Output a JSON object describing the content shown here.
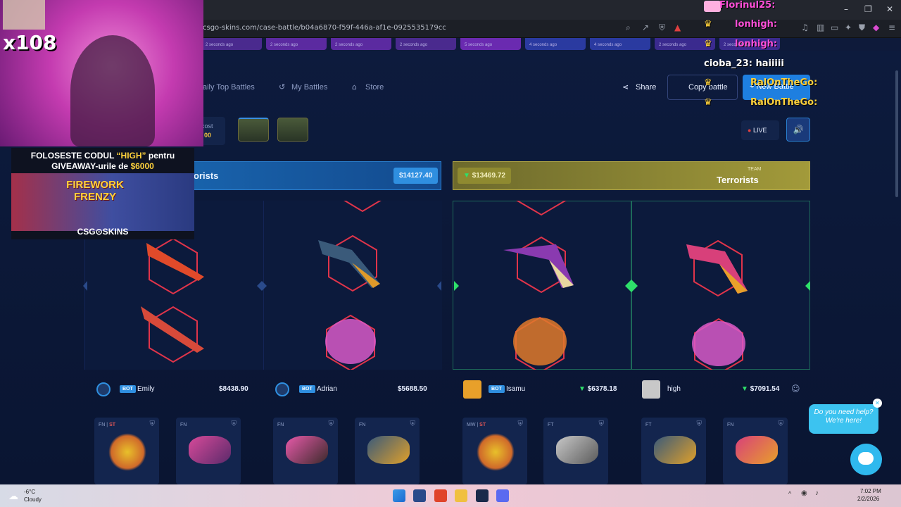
{
  "browser": {
    "url": "csgo-skins.com/case-battle/b04a6870-f59f-446a-af1e-0925535179cc",
    "window_controls": [
      "–",
      "❐",
      "✕"
    ]
  },
  "ticker": {
    "times": [
      "2 seconds ago",
      "2 seconds ago",
      "2 seconds ago",
      "2 seconds ago",
      "5 seconds ago",
      "4 seconds ago",
      "4 seconds ago",
      "2 seconds ago",
      "2 seconds ago"
    ]
  },
  "nav": {
    "daily_top_battles": "aily Top Battles",
    "my_battles": "My Battles",
    "store": "Store",
    "share": "Share",
    "copy_battle": "Copy battle",
    "new_battle": "+ New Battle",
    "live": "LIVE"
  },
  "battle": {
    "cost_label": "cost",
    "cost_value": "00",
    "ct": {
      "name": "orists",
      "value": "$14127.40"
    },
    "t": {
      "team_label": "TEAM",
      "name": "Terrorists",
      "value": "$13469.72"
    }
  },
  "players": [
    {
      "name": "Emily",
      "badge": "BOT",
      "value": "$8438.90"
    },
    {
      "name": "Adrian",
      "badge": "BOT",
      "value": "$5688.50"
    },
    {
      "name": "Isamu",
      "badge": "BOT",
      "value": "$6378.18"
    },
    {
      "name": "high",
      "badge": "",
      "value": "$7091.54"
    }
  ],
  "cards": [
    {
      "cond": "FN",
      "st": "ST"
    },
    {
      "cond": "FN",
      "st": ""
    },
    {
      "cond": "FN",
      "st": ""
    },
    {
      "cond": "FN",
      "st": ""
    },
    {
      "cond": "MW",
      "st": "ST"
    },
    {
      "cond": "FT",
      "st": ""
    },
    {
      "cond": "FT",
      "st": ""
    },
    {
      "cond": "FN",
      "st": ""
    }
  ],
  "stream": {
    "multiplier": "x108",
    "promo_line1": "FOLOSESTE CODUL",
    "promo_code": "“HIGH”",
    "promo_line1_end": "pentru",
    "promo_line2": "GIVEAWAY-urile de",
    "promo_amount": "$6000",
    "promo_game": "FIREWORK FRENZY",
    "promo_brand": "CSG⊙SKINS"
  },
  "chat": [
    {
      "text": "Florinul25:",
      "color": "#ff4fd8"
    },
    {
      "text": "lonhigh:",
      "color": "#ff4fd8"
    },
    {
      "text": "lonhigh:",
      "color": "#ff4fd8"
    },
    {
      "text": "cioba_23: haiiiii",
      "color": "#ffffff"
    },
    {
      "text": "RalOnTheGo:",
      "color": "#ffd23c"
    },
    {
      "text": "RalOnTheGo:",
      "color": "#ffd23c"
    }
  ],
  "help": {
    "line1": "Do you need help?",
    "line2": "We're here!"
  },
  "taskbar": {
    "weather_temp": "-6°C",
    "weather_desc": "Cloudy",
    "time": "7:02 PM",
    "date": "2/2/2026"
  },
  "colors": {
    "ct_blue": "#1b6db8",
    "t_gold": "#a29a3a",
    "hex_red": "#e0344a",
    "accent_green": "#2ee06a",
    "bot_blue": "#2f8fe0"
  }
}
